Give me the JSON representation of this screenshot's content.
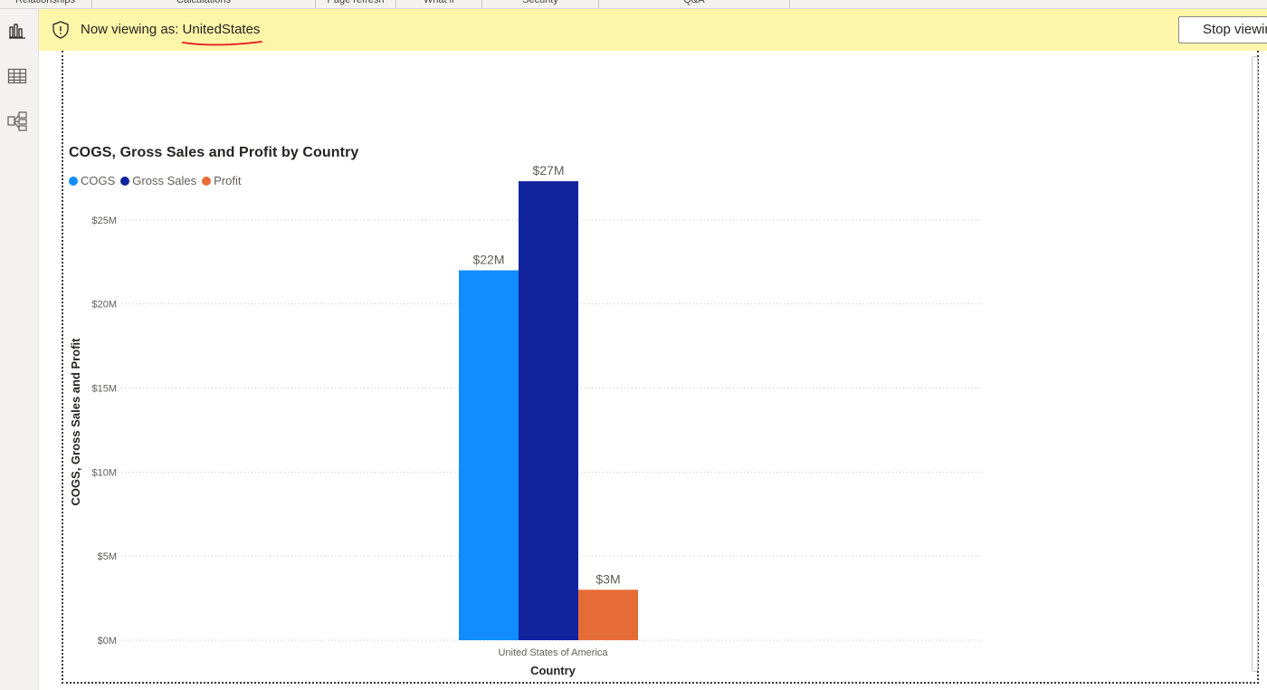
{
  "ribbon": {
    "groups": [
      "Relationships",
      "Calculations",
      "Page refresh",
      "What if",
      "Security",
      "Q&A"
    ]
  },
  "rail": {
    "items": [
      {
        "icon": "report-view-icon",
        "active": true
      },
      {
        "icon": "data-view-icon",
        "active": false
      },
      {
        "icon": "model-view-icon",
        "active": false
      }
    ]
  },
  "banner": {
    "prefix": "Now viewing as: ",
    "role": "UnitedStates",
    "stop_label": "Stop viewing",
    "icon": "shield-icon",
    "background": "#fdf6a9",
    "underline_color": "#e8141c"
  },
  "chart_data": {
    "type": "bar",
    "title": "COGS, Gross Sales and Profit by Country",
    "xlabel": "Country",
    "ylabel": "COGS, Gross Sales and Profit",
    "categories": [
      "United States of America"
    ],
    "series": [
      {
        "name": "COGS",
        "values": [
          22
        ],
        "label": "$22M",
        "color": "#118dff"
      },
      {
        "name": "Gross Sales",
        "values": [
          27.3
        ],
        "label": "$27M",
        "color": "#12239e"
      },
      {
        "name": "Profit",
        "values": [
          3
        ],
        "label": "$3M",
        "color": "#e66c37"
      }
    ],
    "unit": "millions of dollars",
    "yticks": [
      {
        "value": 0,
        "label": "$0M"
      },
      {
        "value": 5,
        "label": "$5M"
      },
      {
        "value": 10,
        "label": "$10M"
      },
      {
        "value": 15,
        "label": "$15M"
      },
      {
        "value": 20,
        "label": "$20M"
      },
      {
        "value": 25,
        "label": "$25M"
      }
    ],
    "ylim": [
      0,
      30
    ],
    "grid": true,
    "legend_position": "top-left"
  }
}
